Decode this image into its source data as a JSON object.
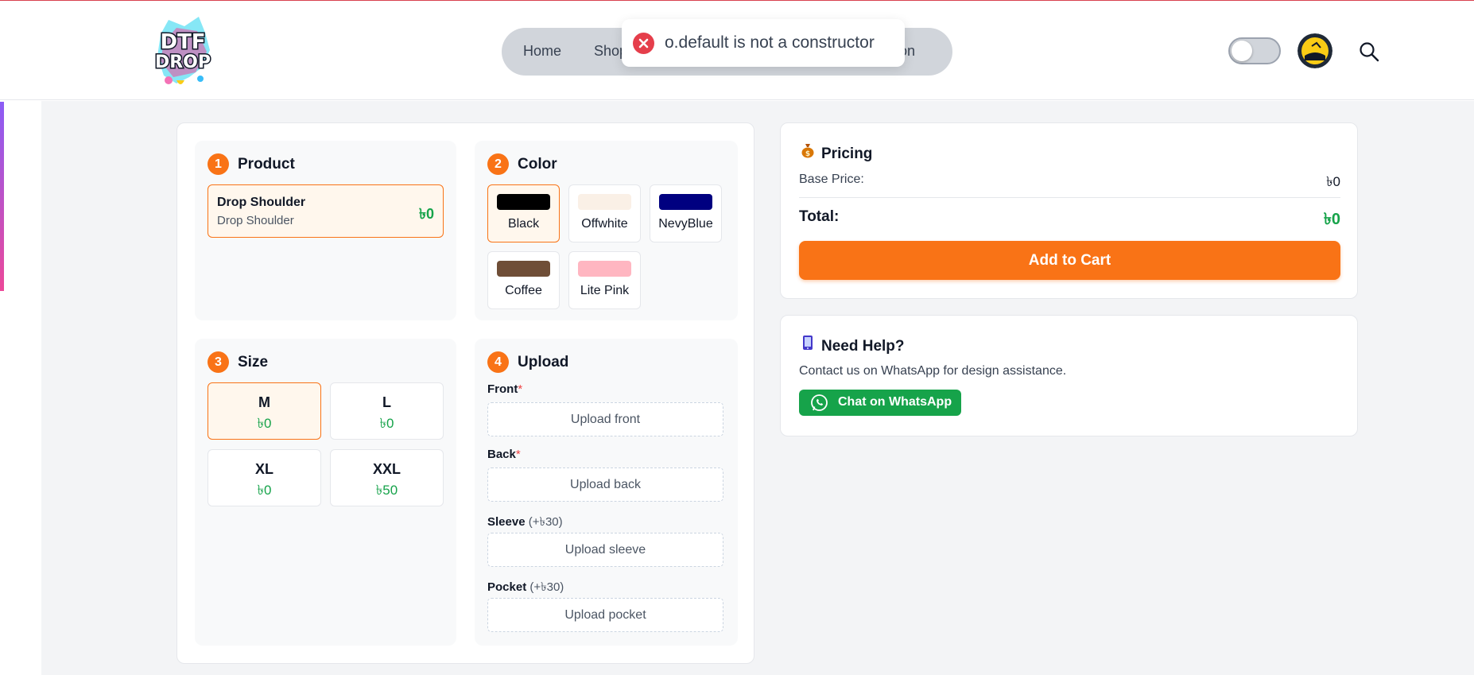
{
  "header": {
    "nav": [
      "Home",
      "Shop",
      "tion"
    ],
    "toast_message": "o.default is not a constructor"
  },
  "builder": {
    "product": {
      "step": "1",
      "title": "Product",
      "option": {
        "name": "Drop Shoulder",
        "subtitle": "Drop Shoulder",
        "price": "৳0"
      }
    },
    "color": {
      "step": "2",
      "title": "Color",
      "options": [
        {
          "label": "Black",
          "swatch": "#000000",
          "selected": true
        },
        {
          "label": "Offwhite",
          "swatch": "#faf0e6",
          "selected": false
        },
        {
          "label": "NevyBlue",
          "swatch": "#000080",
          "selected": false
        },
        {
          "label": "Coffee",
          "swatch": "#6f4e37",
          "selected": false
        },
        {
          "label": "Lite Pink",
          "swatch": "#ffb6c1",
          "selected": false
        }
      ]
    },
    "size": {
      "step": "3",
      "title": "Size",
      "options": [
        {
          "label": "M",
          "price": "৳0",
          "selected": true
        },
        {
          "label": "L",
          "price": "৳0",
          "selected": false
        },
        {
          "label": "XL",
          "price": "৳0",
          "selected": false
        },
        {
          "label": "XXL",
          "price": "৳50",
          "selected": false
        }
      ]
    },
    "upload": {
      "step": "4",
      "title": "Upload",
      "fields": [
        {
          "label": "Front",
          "required": "*",
          "extra": "",
          "button": "Upload front"
        },
        {
          "label": "Back",
          "required": "*",
          "extra": "",
          "button": "Upload back"
        },
        {
          "label": "Sleeve",
          "required": "",
          "extra": "(+৳30)",
          "button": "Upload sleeve"
        },
        {
          "label": "Pocket",
          "required": "",
          "extra": "(+৳30)",
          "button": "Upload pocket"
        }
      ]
    }
  },
  "pricing": {
    "icon": "money-bag-icon",
    "title": "Pricing",
    "base_label": "Base Price:",
    "base_value": "৳0",
    "total_label": "Total:",
    "total_value": "৳0",
    "add_to_cart": "Add to Cart"
  },
  "help": {
    "icon": "phone-icon",
    "title": "Need Help?",
    "text": "Contact us on WhatsApp for design assistance.",
    "whatsapp_label": "Chat on WhatsApp"
  },
  "colors": {
    "accent": "#f97316",
    "price_green": "#16a34a",
    "whatsapp_green": "#16a34a",
    "toast_error": "#e53e4b"
  }
}
